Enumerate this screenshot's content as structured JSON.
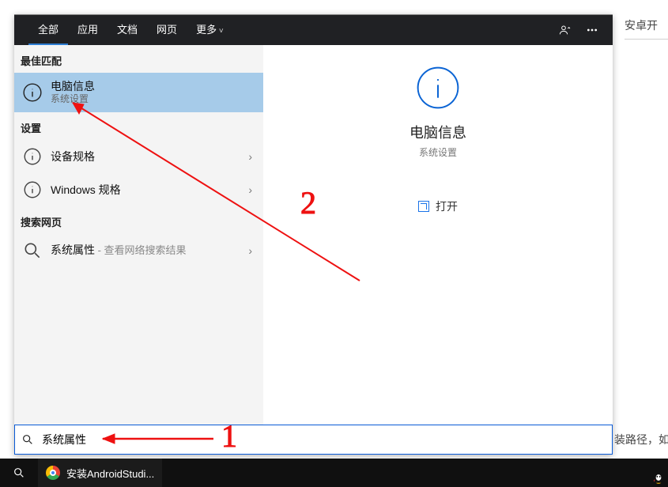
{
  "header": {
    "tabs": [
      "全部",
      "应用",
      "文档",
      "网页",
      "更多"
    ],
    "active_tab_index": 0
  },
  "left": {
    "best_match_label": "最佳匹配",
    "best_match": {
      "title": "电脑信息",
      "subtitle": "系统设置"
    },
    "settings_label": "设置",
    "settings_items": [
      {
        "title": "设备规格"
      },
      {
        "title": "Windows 规格"
      }
    ],
    "web_label": "搜索网页",
    "web_item": {
      "title": "系统属性",
      "suffix": " - 查看网络搜索结果"
    }
  },
  "detail": {
    "title": "电脑信息",
    "subtitle": "系统设置",
    "open_label": "打开"
  },
  "search": {
    "value": "系统属性"
  },
  "taskbar": {
    "app_title": "安装AndroidStudi..."
  },
  "background": {
    "right_text": "安卓开",
    "bottom_text": "装路径，如"
  },
  "annotations": {
    "num1": "1",
    "num2": "2"
  }
}
